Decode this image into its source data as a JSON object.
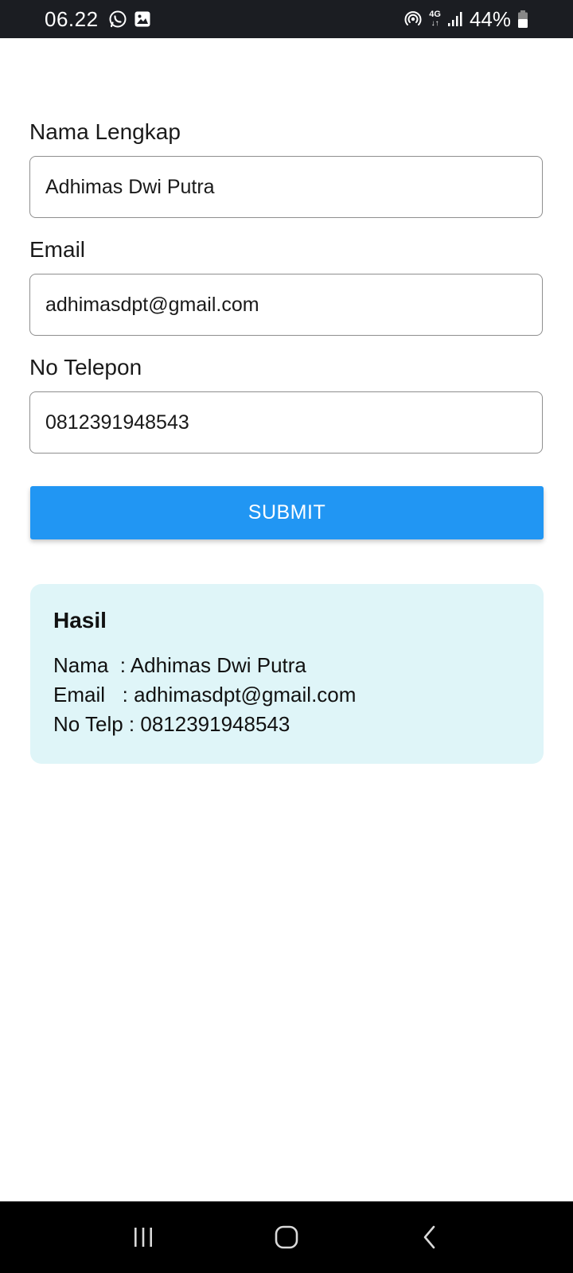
{
  "status_bar": {
    "time": "06.22",
    "network": "4G",
    "battery": "44%"
  },
  "form": {
    "name_label": "Nama Lengkap",
    "name_value": "Adhimas Dwi Putra",
    "email_label": "Email",
    "email_value": "adhimasdpt@gmail.com",
    "phone_label": "No Telepon",
    "phone_value": "0812391948543",
    "submit_label": "SUBMIT"
  },
  "result": {
    "title": "Hasil",
    "line_name": "Nama  : Adhimas Dwi Putra",
    "line_email": "Email   : adhimasdpt@gmail.com",
    "line_phone": "No Telp : 0812391948543"
  },
  "colors": {
    "accent": "#2196f3",
    "result_bg": "#dff5f8",
    "status_bar_bg": "#1b1d22",
    "nav_bar_bg": "#000000"
  },
  "icons": {
    "status_left": [
      "whatsapp-icon",
      "gallery-icon"
    ],
    "status_right": [
      "hotspot-icon",
      "network-4g-icon",
      "signal-icon",
      "battery-icon"
    ],
    "nav": [
      "recent-apps-icon",
      "home-icon",
      "back-icon"
    ]
  }
}
